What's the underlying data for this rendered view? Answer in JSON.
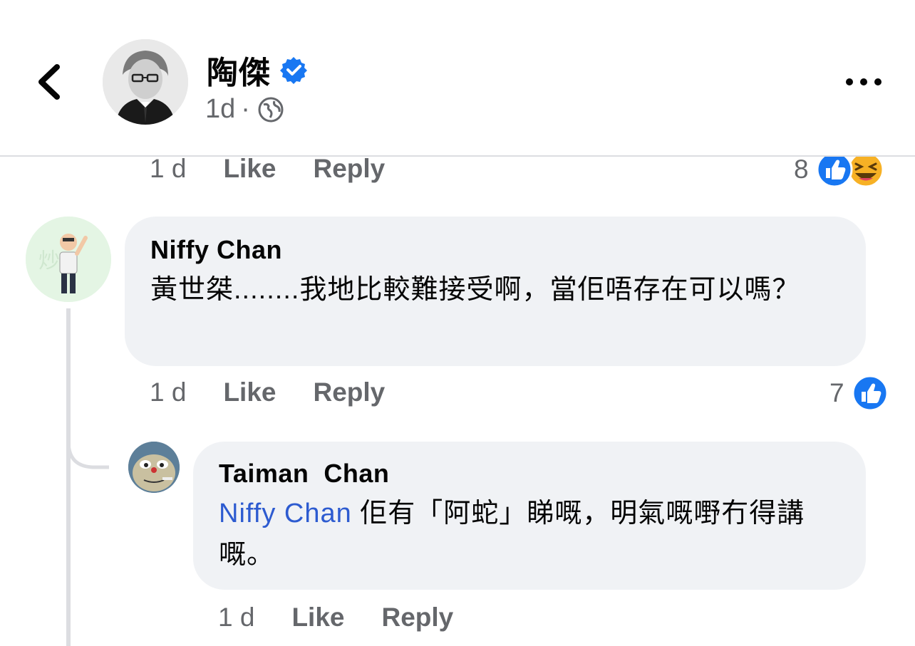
{
  "header": {
    "page_name": "陶傑",
    "post_time": "1d",
    "separator": "·"
  },
  "colors": {
    "like_blue": "#1877f2",
    "haha_yellow": "#f7b125",
    "mention_blue": "#2d5bd0",
    "bubble_bg": "#f0f2f5",
    "meta_gray": "#65676b"
  },
  "icons": [
    "back-chevron-icon",
    "verified-badge-icon",
    "globe-icon",
    "more-options-icon",
    "like-reaction-icon",
    "haha-reaction-icon"
  ],
  "comments": [
    {
      "time": "1 d",
      "like_label": "Like",
      "reply_label": "Reply",
      "reaction_count": "8",
      "reactions": [
        "like",
        "haha"
      ]
    },
    {
      "author": "Niffy Chan",
      "text": "黃世桀........我地比較難接受啊，當佢唔存在可以嗎？",
      "time": "1 d",
      "like_label": "Like",
      "reply_label": "Reply",
      "reaction_count": "7",
      "reactions": [
        "like"
      ]
    },
    {
      "author": "Taiman  Chan",
      "mention": "Niffy Chan",
      "text": " 佢有「阿蛇」睇嘅，明氣嘅嘢冇得講嘅。",
      "time": "1 d",
      "like_label": "Like",
      "reply_label": "Reply"
    }
  ]
}
